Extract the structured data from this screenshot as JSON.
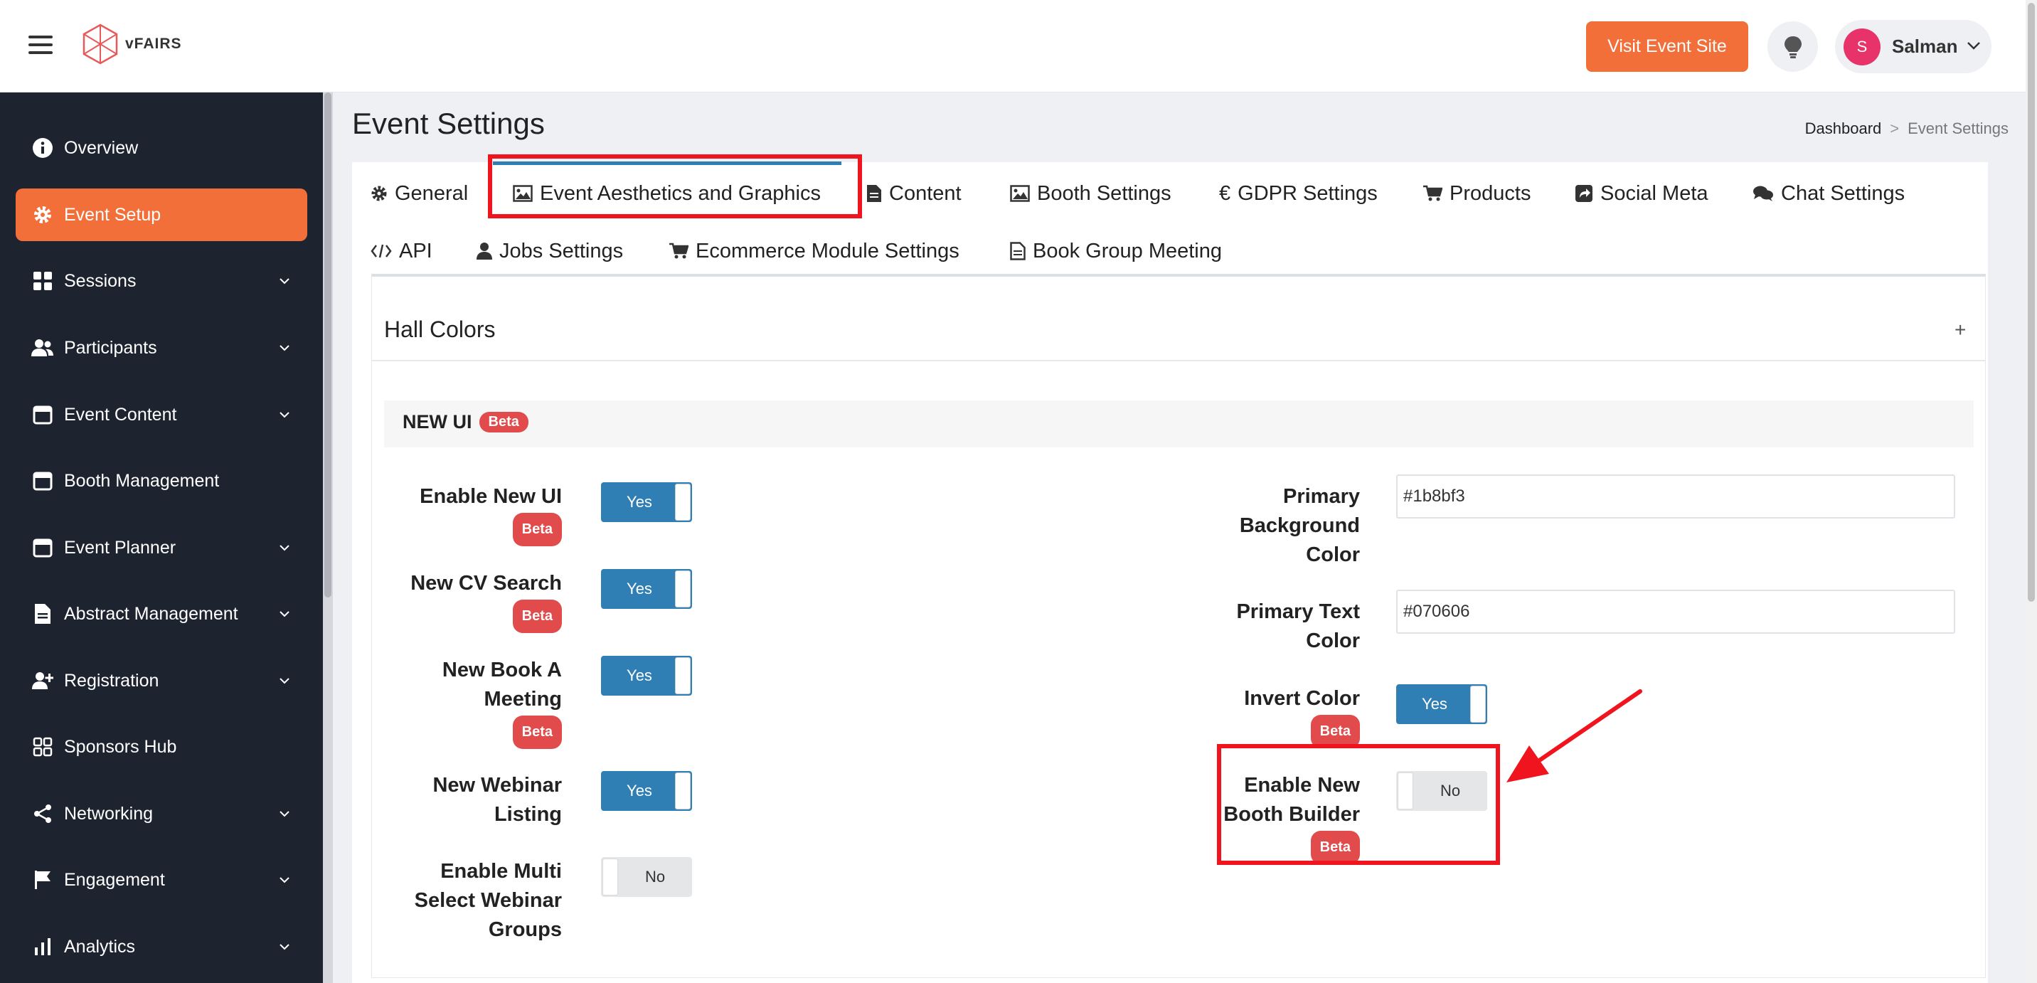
{
  "app": {
    "logo_text": "vFAIRS"
  },
  "header": {
    "visit_label": "Visit Event Site",
    "user_initial": "S",
    "user_name": "Salman"
  },
  "sidebar": {
    "items": [
      {
        "label": "Overview",
        "icon": "info-icon"
      },
      {
        "label": "Event Setup",
        "icon": "gear-icon",
        "active": true
      },
      {
        "label": "Sessions",
        "icon": "grid-icon"
      },
      {
        "label": "Participants",
        "icon": "users-icon"
      },
      {
        "label": "Event Content",
        "icon": "calendar-icon"
      },
      {
        "label": "Booth Management",
        "icon": "calendar-icon"
      },
      {
        "label": "Event Planner",
        "icon": "calendar-icon"
      },
      {
        "label": "Abstract Management",
        "icon": "document-icon"
      },
      {
        "label": "Registration",
        "icon": "user-plus-icon"
      },
      {
        "label": "Sponsors Hub",
        "icon": "apps-icon"
      },
      {
        "label": "Networking",
        "icon": "share-icon"
      },
      {
        "label": "Engagement",
        "icon": "flag-icon"
      },
      {
        "label": "Analytics",
        "icon": "bar-chart-icon"
      }
    ]
  },
  "page": {
    "title": "Event Settings",
    "breadcrumb": [
      "Dashboard",
      "Event Settings"
    ]
  },
  "tabs": [
    {
      "label": "General",
      "icon": "gear-icon"
    },
    {
      "label": "Event Aesthetics and Graphics",
      "icon": "image-icon",
      "active": true
    },
    {
      "label": "Content",
      "icon": "file-icon"
    },
    {
      "label": "Booth Settings",
      "icon": "image-icon"
    },
    {
      "label": "GDPR Settings",
      "icon": "euro-icon"
    },
    {
      "label": "Products",
      "icon": "cart-icon"
    },
    {
      "label": "Social Meta",
      "icon": "share-square-icon"
    },
    {
      "label": "Chat Settings",
      "icon": "chat-icon"
    },
    {
      "label": "API",
      "icon": "code-icon"
    },
    {
      "label": "Jobs Settings",
      "icon": "user-icon"
    },
    {
      "label": "Ecommerce Module Settings",
      "icon": "cart-icon"
    },
    {
      "label": "Book Group Meeting",
      "icon": "file-text-icon"
    }
  ],
  "panel": {
    "title": "Hall Colors",
    "expand_symbol": "+"
  },
  "section": {
    "title": "NEW UI",
    "badge": "Beta"
  },
  "left_fields": [
    {
      "label": "Enable New UI",
      "beta": "Beta",
      "value": "Yes"
    },
    {
      "label": "New CV Search",
      "beta": "Beta",
      "value": "Yes"
    },
    {
      "label": "New Book A Meeting",
      "beta": "Beta",
      "value": "Yes"
    },
    {
      "label": "New Webinar Listing",
      "value": "Yes"
    },
    {
      "label": "Enable Multi Select Webinar Groups",
      "value": "No"
    }
  ],
  "right_fields": {
    "primary_bg": {
      "label": "Primary Background Color",
      "value": "#1b8bf3"
    },
    "primary_text": {
      "label": "Primary Text Color",
      "value": "#070606"
    },
    "invert": {
      "label": "Invert Color",
      "beta": "Beta",
      "value": "Yes"
    },
    "booth_builder": {
      "label": "Enable New Booth Builder",
      "beta": "Beta",
      "value": "No"
    }
  },
  "colors": {
    "accent": "#f26f3a",
    "sidebar_bg": "#1e2330",
    "toggle_on": "#2f7fb5",
    "beta_badge": "#e24b4b",
    "annotation": "#f0141e"
  }
}
